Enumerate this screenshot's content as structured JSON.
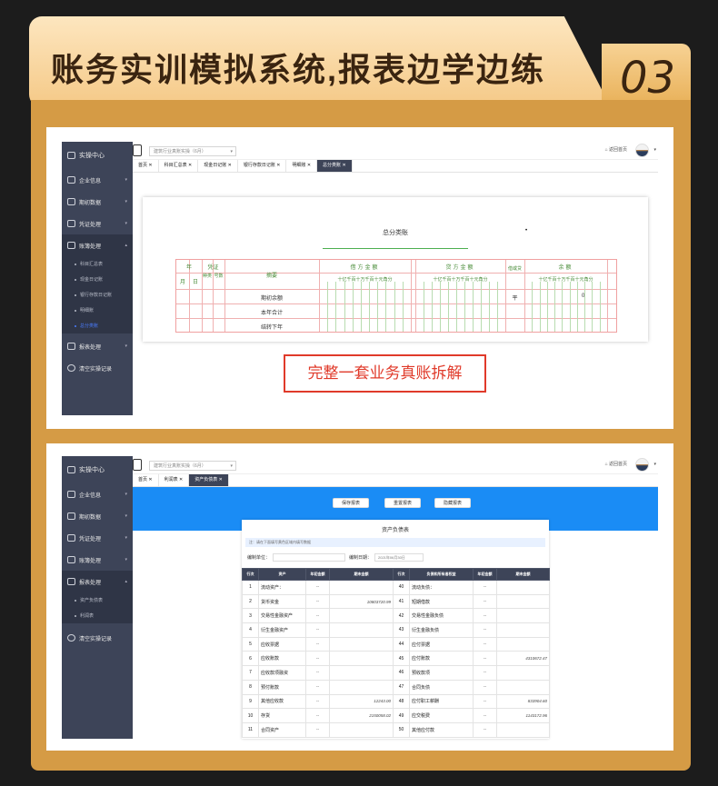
{
  "banner": {
    "title": "账务实训模拟系统,报表边学边练",
    "number": "03"
  },
  "app": {
    "menu_title": "实操中心",
    "company_select": "建筑行业真账实操（6月）",
    "home_link": "返回首页",
    "nav_icon": "home-icon"
  },
  "panel1": {
    "sidebar": [
      {
        "label": "企业信息"
      },
      {
        "label": "期初数据"
      },
      {
        "label": "凭证处理"
      },
      {
        "label": "账簿处理",
        "active": true
      },
      {
        "label": "报表处理"
      },
      {
        "label": "清空实操记录"
      }
    ],
    "sub_items": [
      "科目汇总表",
      "现金日记账",
      "银行存款日记账",
      "明细账",
      "总分类账"
    ],
    "tabs": [
      "首页",
      "科目汇总表",
      "现金日记账",
      "银行存款日记账",
      "明细账",
      "总分类账"
    ],
    "ledger": {
      "title": "总分类账",
      "dot": "•",
      "headers": {
        "year": "年",
        "voucher": "凭证",
        "month": "月",
        "day": "日",
        "kind": "种类",
        "no": "号数",
        "summary": "摘要",
        "debit": "借方金额",
        "credit": "贷方金额",
        "dir": "借或贷",
        "balance": "余额",
        "digits": "十亿千百十万千百十元角分"
      },
      "rows": [
        "期初余额",
        "本年合计",
        "结转下年"
      ],
      "dir_value": "平",
      "balance_value": "0"
    },
    "highlight": "完整一套业务真账拆解"
  },
  "panel2": {
    "sidebar": [
      {
        "label": "企业信息"
      },
      {
        "label": "期初数据"
      },
      {
        "label": "凭证处理"
      },
      {
        "label": "账簿处理"
      },
      {
        "label": "报表处理",
        "active": true
      },
      {
        "label": "清空实操记录"
      }
    ],
    "sub_items": [
      "资产负债表",
      "利润表"
    ],
    "tabs": [
      "首页",
      "利润表",
      "资产负债表"
    ],
    "buttons": [
      "保存报表",
      "重置报表",
      "隐藏报表"
    ],
    "sheet": {
      "title": "资产负债表",
      "note": "注：请在下面填写黄色区域内填写数据",
      "unit_label": "编制单位：",
      "date_label": "编制日期：",
      "date_value": "2021年06月30日",
      "headers": [
        "行次",
        "资产",
        "年初金额",
        "期末金额",
        "行次",
        "负债和所有者权益",
        "年初金额",
        "期末金额"
      ],
      "rows": [
        [
          "1",
          "流动资产：",
          "--",
          "",
          "40",
          "流动负债：",
          "--",
          ""
        ],
        [
          "2",
          "货币资金",
          "--",
          "10803720.99",
          "41",
          "短期借款",
          "--",
          ""
        ],
        [
          "3",
          "交易性金融资产",
          "--",
          "",
          "42",
          "交易性金融负债",
          "--",
          ""
        ],
        [
          "4",
          "衍生金融资产",
          "--",
          "",
          "43",
          "衍生金融负债",
          "--",
          ""
        ],
        [
          "5",
          "应收票据",
          "--",
          "",
          "44",
          "应付票据",
          "--",
          ""
        ],
        [
          "6",
          "应收账款",
          "--",
          "",
          "45",
          "应付账款",
          "--",
          "4310672.47"
        ],
        [
          "7",
          "应收款项融资",
          "--",
          "",
          "46",
          "预收款项",
          "--",
          ""
        ],
        [
          "8",
          "预付账款",
          "--",
          "",
          "47",
          "合同负债",
          "--",
          ""
        ],
        [
          "9",
          "其他应收款",
          "--",
          "12243.00",
          "48",
          "应付职工薪酬",
          "--",
          "833904.60"
        ],
        [
          "10",
          "存货",
          "--",
          "2150058.02",
          "49",
          "应交税费",
          "--",
          "1143172.96"
        ],
        [
          "11",
          "合同资产",
          "--",
          "",
          "50",
          "其他应付款",
          "--",
          ""
        ]
      ]
    }
  },
  "colors": {
    "frame": "#d59b45",
    "sidebar": "#3d4458",
    "accent_blue": "#1a8cf5",
    "highlight_red": "#e03a2a"
  }
}
